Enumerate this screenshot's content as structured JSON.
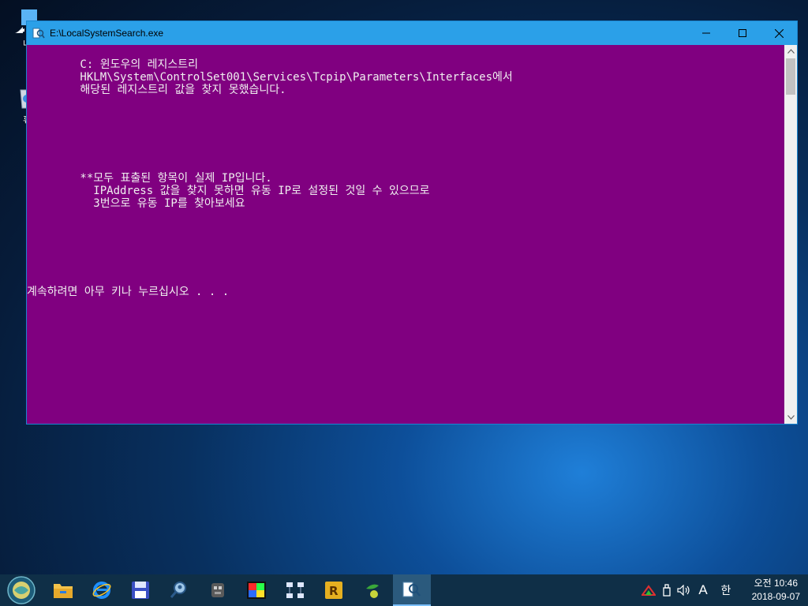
{
  "desktop": {
    "icons": [
      {
        "label": "내",
        "icon": "this-pc-icon"
      },
      {
        "label": "휴",
        "icon": "recycle-bin-icon"
      }
    ]
  },
  "window": {
    "title": "E:\\LocalSystemSearch.exe",
    "controls": {
      "minimize": "minimize-icon",
      "maximize": "maximize-icon",
      "close": "close-icon"
    }
  },
  "console": {
    "background": "#800080",
    "foreground": "#f0f0f0",
    "lines": [
      "        C: 윈도우의 레지스트리",
      "        HKLM\\System\\ControlSet001\\Services\\Tcpip\\Parameters\\Interfaces에서",
      "        해당된 레지스트리 값을 찾지 못했습니다.",
      "        **모두 표출된 항목이 실제 IP입니다.",
      "          IPAddress 값을 찾지 못하면 유동 IP로 설정된 것일 수 있으므로",
      "          3번으로 유동 IP를 찾아보세요",
      "계속하려면 아무 키나 누르십시오 . . ."
    ]
  },
  "taskbar": {
    "pinned": [
      "start-icon",
      "file-explorer-icon",
      "internet-explorer-icon",
      "save-disk-icon",
      "search-user-icon",
      "robot-app-icon",
      "color-palette-icon",
      "network-app-icon",
      "r-app-icon",
      "olive-app-icon",
      "local-system-search-icon"
    ],
    "tray": {
      "ime_mode": "A",
      "ime_lang": "한"
    },
    "clock": {
      "time": "오전 10:46",
      "date": "2018-09-07"
    }
  },
  "colors": {
    "accent": "#2ba0e8",
    "taskbar": "#0f2f47"
  }
}
